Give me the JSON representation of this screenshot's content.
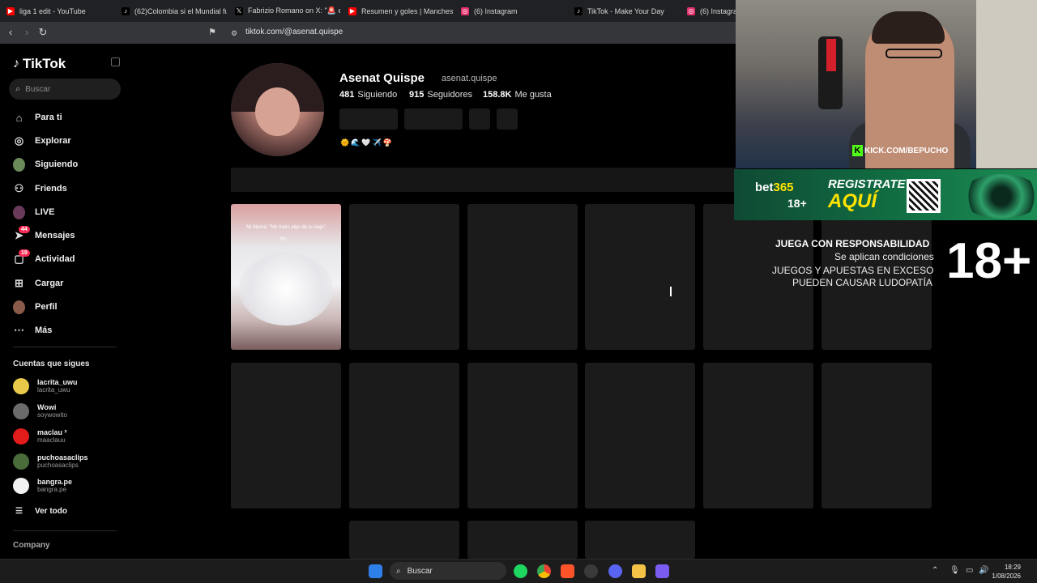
{
  "browser": {
    "tabs": [
      {
        "title": "liga 1 edit - YouTube",
        "icon": "youtube-icon",
        "color": "#ff0000"
      },
      {
        "title": "(62)Colombia si el Mundial fu",
        "icon": "tiktok-icon",
        "color": "#ffffff"
      },
      {
        "title": "Fabrizio Romano on X: \"🚨 es l",
        "icon": "x-icon",
        "color": "#ffffff"
      },
      {
        "title": "Resumen y goles | Mancheste",
        "icon": "youtube-icon",
        "color": "#ff0000"
      },
      {
        "title": "(6) Instagram",
        "icon": "instagram-icon",
        "color": "#e1306c"
      },
      {
        "title": "TikTok - Make Your Day",
        "icon": "tiktok-icon",
        "color": "#ffffff"
      },
      {
        "title": "(6) Instagram",
        "icon": "instagram-icon",
        "color": "#e1306c"
      }
    ],
    "url": "tiktok.com/@asenat.quispe"
  },
  "sidebar": {
    "logo": "TikTok",
    "search_placeholder": "Buscar",
    "nav": [
      {
        "label": "Para ti",
        "icon": "home-icon"
      },
      {
        "label": "Explorar",
        "icon": "compass-icon"
      },
      {
        "label": "Siguiendo",
        "icon": "following-avatar-icon"
      },
      {
        "label": "Friends",
        "icon": "friends-icon"
      },
      {
        "label": "LIVE",
        "icon": "live-icon"
      },
      {
        "label": "Mensajes",
        "icon": "send-icon",
        "badge": "44"
      },
      {
        "label": "Actividad",
        "icon": "inbox-icon",
        "badge": "19"
      },
      {
        "label": "Cargar",
        "icon": "upload-icon"
      },
      {
        "label": "Perfil",
        "icon": "profile-avatar-icon"
      },
      {
        "label": "Más",
        "icon": "more-icon"
      }
    ],
    "following_title": "Cuentas que sigues",
    "accounts": [
      {
        "name": "lacrita_uwu",
        "handle": "lacrita_uwu",
        "color": "#e8c94a"
      },
      {
        "name": "Wowi",
        "handle": "soywowito",
        "color": "#6b6b6b"
      },
      {
        "name": "maclau ²",
        "handle": "maaclauu",
        "color": "#e21b1b"
      },
      {
        "name": "puchoasaclips",
        "handle": "puchoasaclips",
        "color": "#4a6b3a"
      },
      {
        "name": "bangra.pe",
        "handle": "bangra.pe",
        "color": "#f2f2f2"
      }
    ],
    "see_all": "Ver todo",
    "company": "Company"
  },
  "profile": {
    "display_name": "Asenat Quispe",
    "handle": "asenat.quispe",
    "following_count": "481",
    "following_label": "Siguiendo",
    "followers_count": "915",
    "followers_label": "Seguidores",
    "likes_count": "158.8K",
    "likes_label": "Me gusta",
    "bio_emojis": "🌞🌊🤍✈️🍄",
    "first_video_caption": "Mi Mamá: \"Me traes algo de tu viaje\"",
    "first_video_subtext": "Yo:"
  },
  "overlay": {
    "kick_text": "KICK.COM/BEPUCHO",
    "bet_logo_main": "bet",
    "bet_logo_num": "365",
    "bet_age": "18+",
    "bet_register": "REGISTRATE",
    "bet_aqui": "AQUÍ",
    "warning_1": "JUEGA CON RESPONSABILIDAD",
    "warning_2": "Se aplican condiciones",
    "warning_3": "JUEGOS Y APUESTAS EN EXCESO",
    "warning_4": "PUEDEN CAUSAR LUDOPATÍA",
    "big_age": "18+"
  },
  "taskbar": {
    "search_label": "Buscar",
    "time": "18:29",
    "date": "1/08/2026"
  }
}
